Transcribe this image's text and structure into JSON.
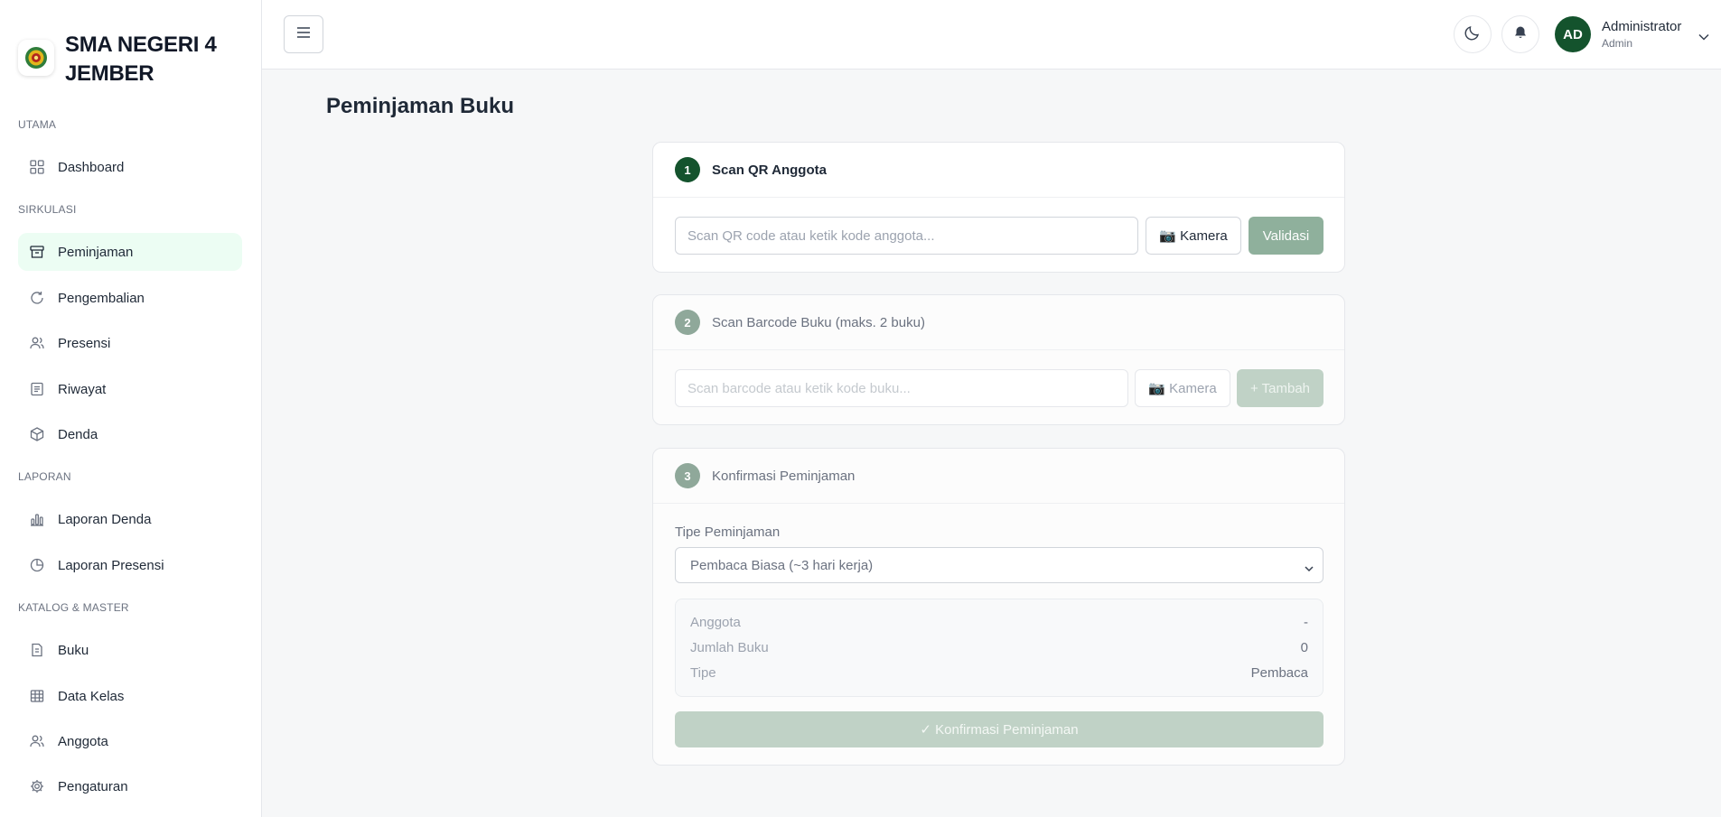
{
  "brand": {
    "name": "SMA NEGERI 4 JEMBER",
    "logo_icon": "school-emblem-icon"
  },
  "sidebar": {
    "sections": [
      {
        "label": "UTAMA"
      },
      {
        "label": "SIRKULASI"
      },
      {
        "label": "LAPORAN"
      },
      {
        "label": "KATALOG & MASTER"
      }
    ],
    "items": [
      {
        "label": "Dashboard",
        "icon": "grid-icon"
      },
      {
        "label": "Peminjaman",
        "icon": "archive-box-icon",
        "active": true
      },
      {
        "label": "Pengembalian",
        "icon": "refresh-icon"
      },
      {
        "label": "Presensi",
        "icon": "users-icon"
      },
      {
        "label": "Riwayat",
        "icon": "list-icon"
      },
      {
        "label": "Denda",
        "icon": "package-icon"
      },
      {
        "label": "Laporan Denda",
        "icon": "bar-chart-icon"
      },
      {
        "label": "Laporan Presensi",
        "icon": "pie-chart-icon"
      },
      {
        "label": "Buku",
        "icon": "book-icon"
      },
      {
        "label": "Data Kelas",
        "icon": "table-icon"
      },
      {
        "label": "Anggota",
        "icon": "users-icon"
      },
      {
        "label": "Pengaturan",
        "icon": "gear-icon"
      }
    ]
  },
  "header": {
    "user": {
      "initials": "AD",
      "name": "Administrator",
      "role": "Admin"
    }
  },
  "page": {
    "title": "Peminjaman Buku",
    "step1": {
      "number": "1",
      "title": "Scan QR Anggota",
      "input_placeholder": "Scan QR code atau ketik kode anggota...",
      "camera_label": "📷 Kamera",
      "validate_label": "Validasi"
    },
    "step2": {
      "number": "2",
      "title": "Scan Barcode Buku (maks. 2 buku)",
      "input_placeholder": "Scan barcode atau ketik kode buku...",
      "camera_label": "📷 Kamera",
      "add_label": "+ Tambah"
    },
    "step3": {
      "number": "3",
      "title": "Konfirmasi Peminjaman",
      "type_label": "Tipe Peminjaman",
      "type_selected": "Pembaca Biasa (~3 hari kerja)",
      "summary": [
        {
          "key": "Anggota",
          "value": "-"
        },
        {
          "key": "Jumlah Buku",
          "value": "0"
        },
        {
          "key": "Tipe",
          "value": "Pembaca"
        }
      ],
      "confirm_label": "✓ Konfirmasi Peminjaman"
    }
  },
  "colors": {
    "accent": "#14532d",
    "active_bg": "#ecfdf3",
    "disabled_green": "#8fb09c"
  }
}
